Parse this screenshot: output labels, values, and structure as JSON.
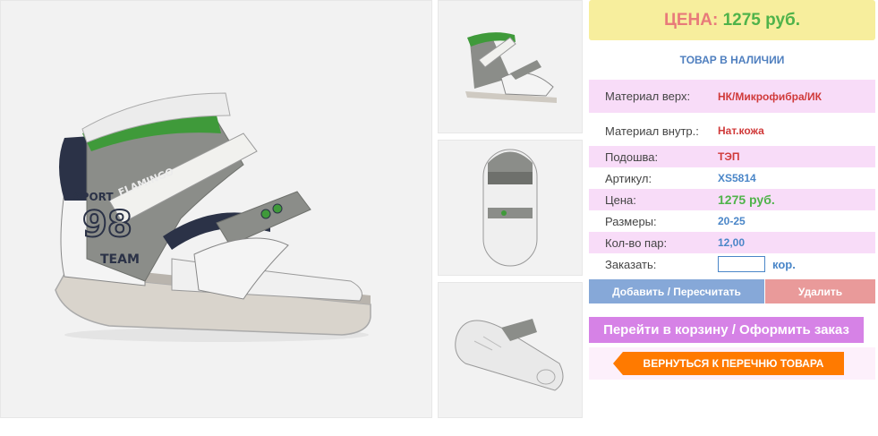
{
  "price_banner": {
    "label": "ЦЕНА:",
    "value": "1275 руб."
  },
  "stock_status": "ТОВАР В НАЛИЧИИ",
  "specs": [
    {
      "key": "Материал верх:",
      "value": "НК/Микрофибра/ИК"
    },
    {
      "key": "Материал внутр.:",
      "value": "Нат.кожа"
    },
    {
      "key": "Подошва:",
      "value": "ТЭП"
    },
    {
      "key": "Артикул:",
      "value": "XS5814"
    },
    {
      "key": "Цена:",
      "value": "1275 руб."
    },
    {
      "key": "Размеры:",
      "value": "20-25"
    },
    {
      "key": "Кол-во пар:",
      "value": "12,00"
    }
  ],
  "order": {
    "label": "Заказать:",
    "value": "",
    "unit": "кор."
  },
  "buttons": {
    "add": "Добавить / Пересчитать",
    "delete": "Удалить",
    "cart": "Перейти в корзину / Оформить заказ",
    "back": "ВЕРНУТЬСЯ К ПЕРЕЧНЮ ТОВАРА"
  },
  "shoe_print": {
    "brand": "FLAMINGO",
    "sport": "SPORT",
    "number": "98",
    "team": "TEAM"
  },
  "colors": {
    "price_label": "#e87a7a",
    "price_value": "#4fb34a",
    "accent_blue": "#4a86c8",
    "accent_red": "#d03a3a",
    "row_pink": "#f8dcf8",
    "button_orange": "#ff7a00",
    "button_purple": "#d682e6"
  }
}
